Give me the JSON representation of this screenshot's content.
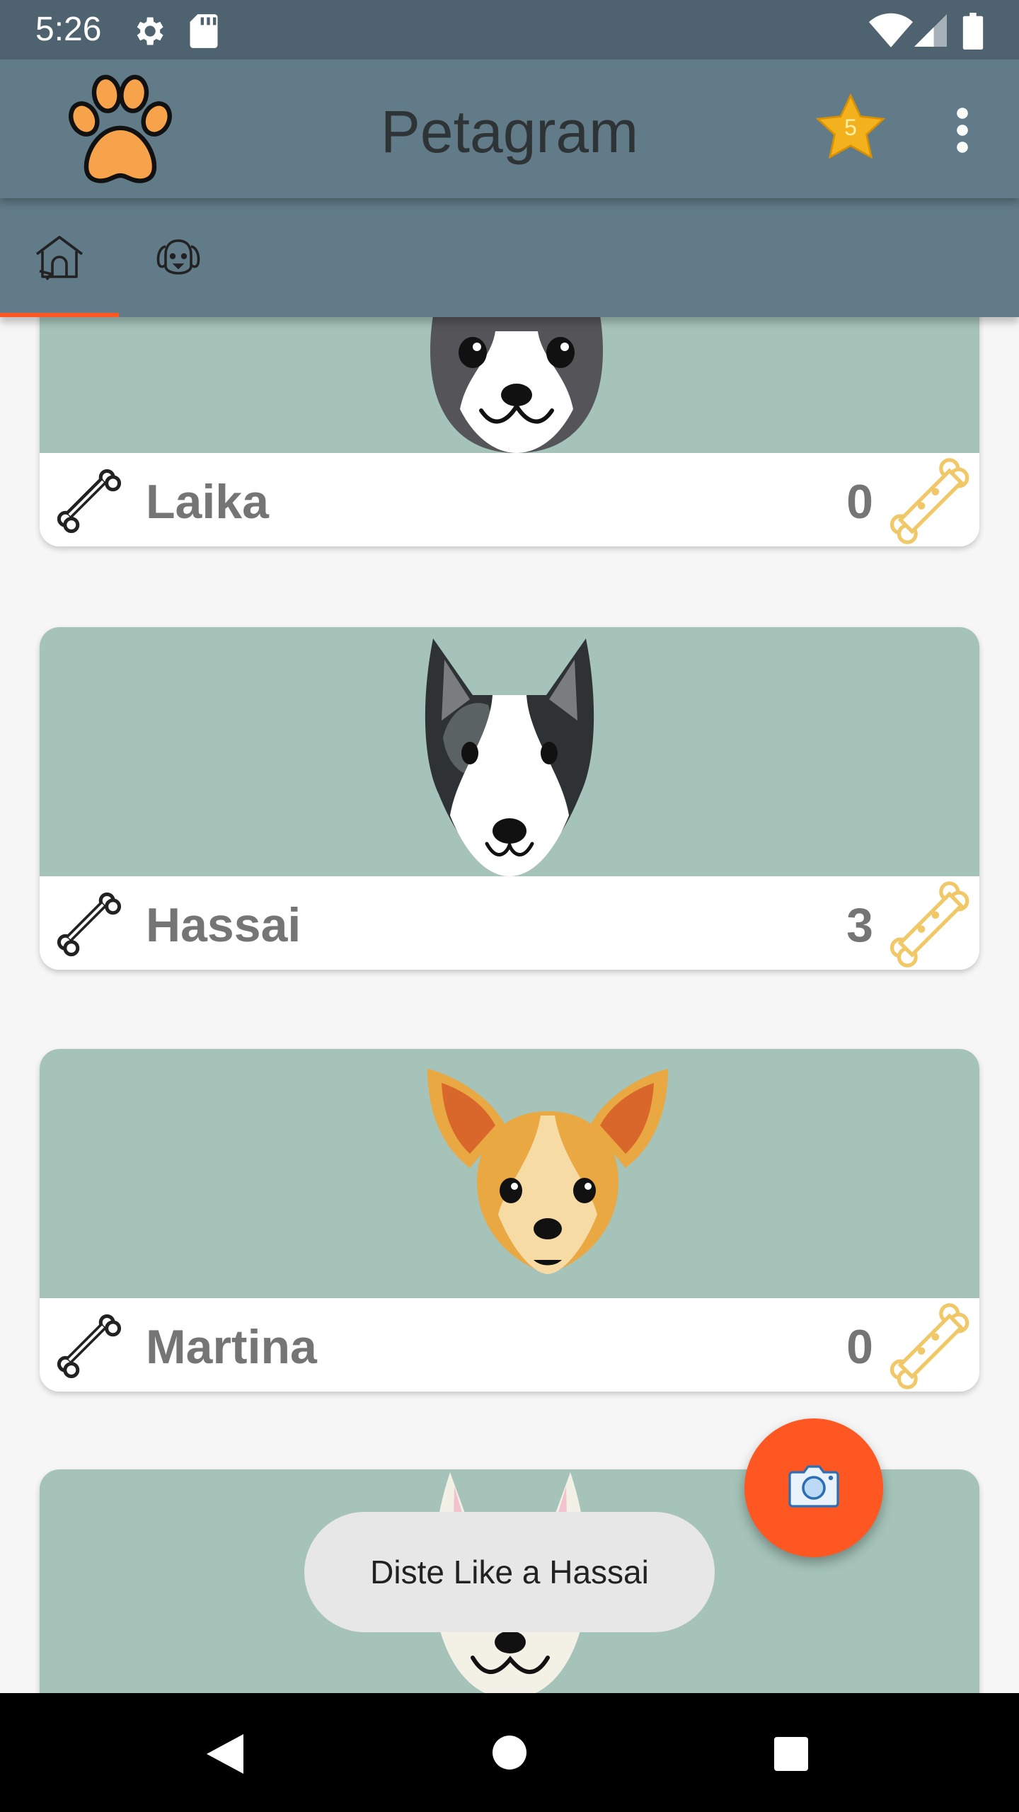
{
  "status_bar": {
    "time": "5:26",
    "icons": [
      "settings-icon",
      "sd-card-icon",
      "wifi-icon",
      "signal-icon",
      "battery-icon"
    ]
  },
  "app_bar": {
    "title": "Petagram",
    "favorites_count": "5",
    "logo_icon": "paw-icon",
    "menu_icon": "overflow-menu-icon"
  },
  "tabs": [
    {
      "icon": "dog-house-icon",
      "selected": true
    },
    {
      "icon": "dog-face-icon",
      "selected": false
    }
  ],
  "pets": [
    {
      "name": "Laika",
      "likes": "0",
      "image": "dog-portrait"
    },
    {
      "name": "Hassai",
      "likes": "3",
      "image": "dog-portrait"
    },
    {
      "name": "Martina",
      "likes": "0",
      "image": "dog-portrait"
    },
    {
      "name": "",
      "likes": "",
      "image": "dog-portrait"
    }
  ],
  "fab": {
    "icon": "camera-icon"
  },
  "toast": {
    "message": "Diste Like a Hassai"
  },
  "nav": {
    "icons": [
      "back-icon",
      "home-icon",
      "recents-icon"
    ]
  },
  "colors": {
    "status_bar": "#4f6270",
    "app_bar": "#617b88",
    "card_image": "#a5c3b9",
    "accent": "#ff5722",
    "bone_outline": "#f0c868",
    "text_gray": "#757575"
  }
}
